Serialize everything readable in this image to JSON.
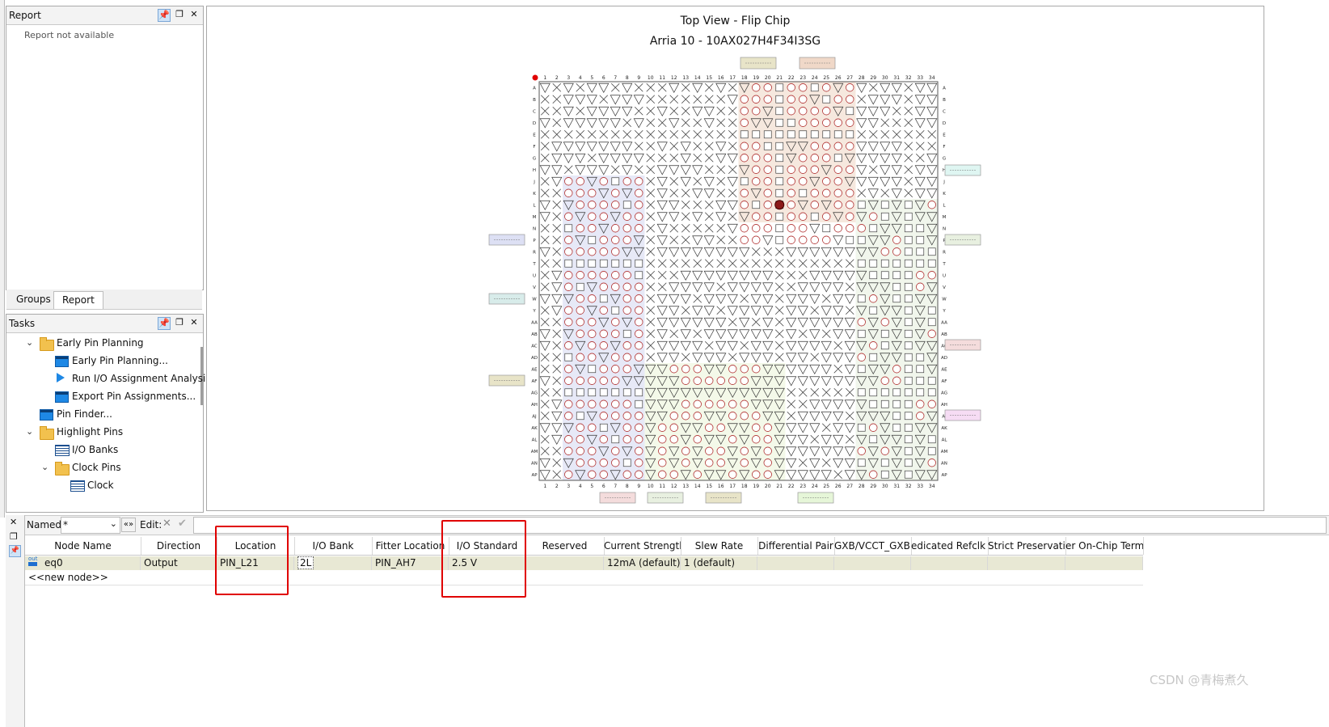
{
  "report_panel": {
    "title": "Report",
    "message": "Report not available"
  },
  "left_tabs": [
    "Groups",
    "Report"
  ],
  "tasks_panel": {
    "title": "Tasks",
    "items": [
      {
        "label": "Early Pin Planning",
        "kind": "folder",
        "level": 1,
        "expanded": true
      },
      {
        "label": "Early Pin Planning...",
        "kind": "window",
        "level": 2
      },
      {
        "label": "Run I/O Assignment Analysi",
        "kind": "run",
        "level": 2
      },
      {
        "label": "Export Pin Assignments...",
        "kind": "window",
        "level": 2
      },
      {
        "label": "Pin Finder...",
        "kind": "window",
        "level": 1
      },
      {
        "label": "Highlight Pins",
        "kind": "folder",
        "level": 1,
        "expanded": true
      },
      {
        "label": "I/O Banks",
        "kind": "grid",
        "level": 2
      },
      {
        "label": "Clock Pins",
        "kind": "folder",
        "level": 2,
        "expanded": true
      },
      {
        "label": "Clock",
        "kind": "grid",
        "level": 3
      }
    ]
  },
  "chip_view": {
    "title": "Top View - Flip Chip",
    "subtitle": "Arria 10 - 10AX027H4F34I3SG",
    "columns": [
      "1",
      "2",
      "3",
      "4",
      "5",
      "6",
      "7",
      "8",
      "9",
      "10",
      "11",
      "12",
      "13",
      "14",
      "15",
      "16",
      "17",
      "18",
      "19",
      "20",
      "21",
      "22",
      "23",
      "24",
      "25",
      "26",
      "27",
      "28",
      "29",
      "30",
      "31",
      "32",
      "33",
      "34"
    ],
    "rows": [
      "A",
      "B",
      "C",
      "D",
      "E",
      "F",
      "G",
      "H",
      "J",
      "K",
      "L",
      "M",
      "N",
      "P",
      "R",
      "T",
      "U",
      "V",
      "W",
      "Y",
      "AA",
      "AB",
      "AC",
      "AD",
      "AE",
      "AF",
      "AG",
      "AH",
      "AJ",
      "AK",
      "AL",
      "AM",
      "AN",
      "AP"
    ],
    "bank_colors": [
      "#e8e4c8",
      "#f0d8c8",
      "#dde0f4",
      "#d8ecea",
      "#e8f0e0",
      "#f4dcdc",
      "#f6dcf4",
      "#eaf4d4",
      "#e6f6d8"
    ]
  },
  "filter_bar": {
    "named_label": "Named:",
    "named_value": "*",
    "edit_label": "Edit:"
  },
  "table": {
    "headers": [
      "Node Name",
      "Direction",
      "Location",
      "I/O Bank",
      "Fitter Location",
      "I/O Standard",
      "Reserved",
      "Current Strength",
      "Slew Rate",
      "Differential Pair",
      "GXB/VCCT_GXB V",
      "edicated Refclk Pi",
      "Strict Preservatior",
      "er On-Chip Termi"
    ],
    "rows": [
      {
        "icon_text": "out",
        "node_name": "eq0",
        "direction": "Output",
        "location": "PIN_L21",
        "io_bank": "2L",
        "fitter_location": "PIN_AH7",
        "io_standard": "2.5 V",
        "reserved": "",
        "current_strength": "12mA (default)",
        "slew_rate": "1 (default)"
      }
    ],
    "new_node": "<<new node>>"
  },
  "watermark": "CSDN @青梅煮久"
}
